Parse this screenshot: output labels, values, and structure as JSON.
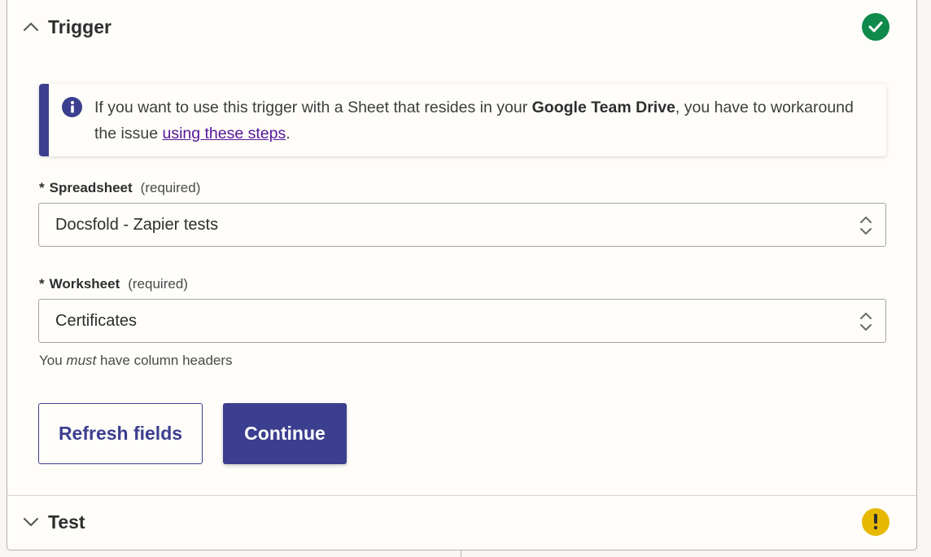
{
  "trigger_section": {
    "title": "Trigger",
    "status_icon": "check-circle-icon",
    "status_color": "#0f8a4b"
  },
  "alert": {
    "icon": "info-icon",
    "text_before": "If you want to use this trigger with a Sheet that resides in your ",
    "text_bold": "Google Team Drive",
    "text_after": ", you have to workaround the issue ",
    "link_text": "using these steps",
    "text_end": ".",
    "accent_color": "#3c3e8f"
  },
  "spreadsheet_field": {
    "required_marker": "*",
    "label": "Spreadsheet",
    "required_text": "(required)",
    "value": "Docsfold - Zapier tests"
  },
  "worksheet_field": {
    "required_marker": "*",
    "label": "Worksheet",
    "required_text": "(required)",
    "value": "Certificates",
    "help_before": "You ",
    "help_em": "must",
    "help_after": " have column headers"
  },
  "buttons": {
    "refresh_label": "Refresh fields",
    "continue_label": "Continue"
  },
  "test_section": {
    "title": "Test",
    "status_icon": "warning-icon",
    "status_color": "#e6b800"
  }
}
